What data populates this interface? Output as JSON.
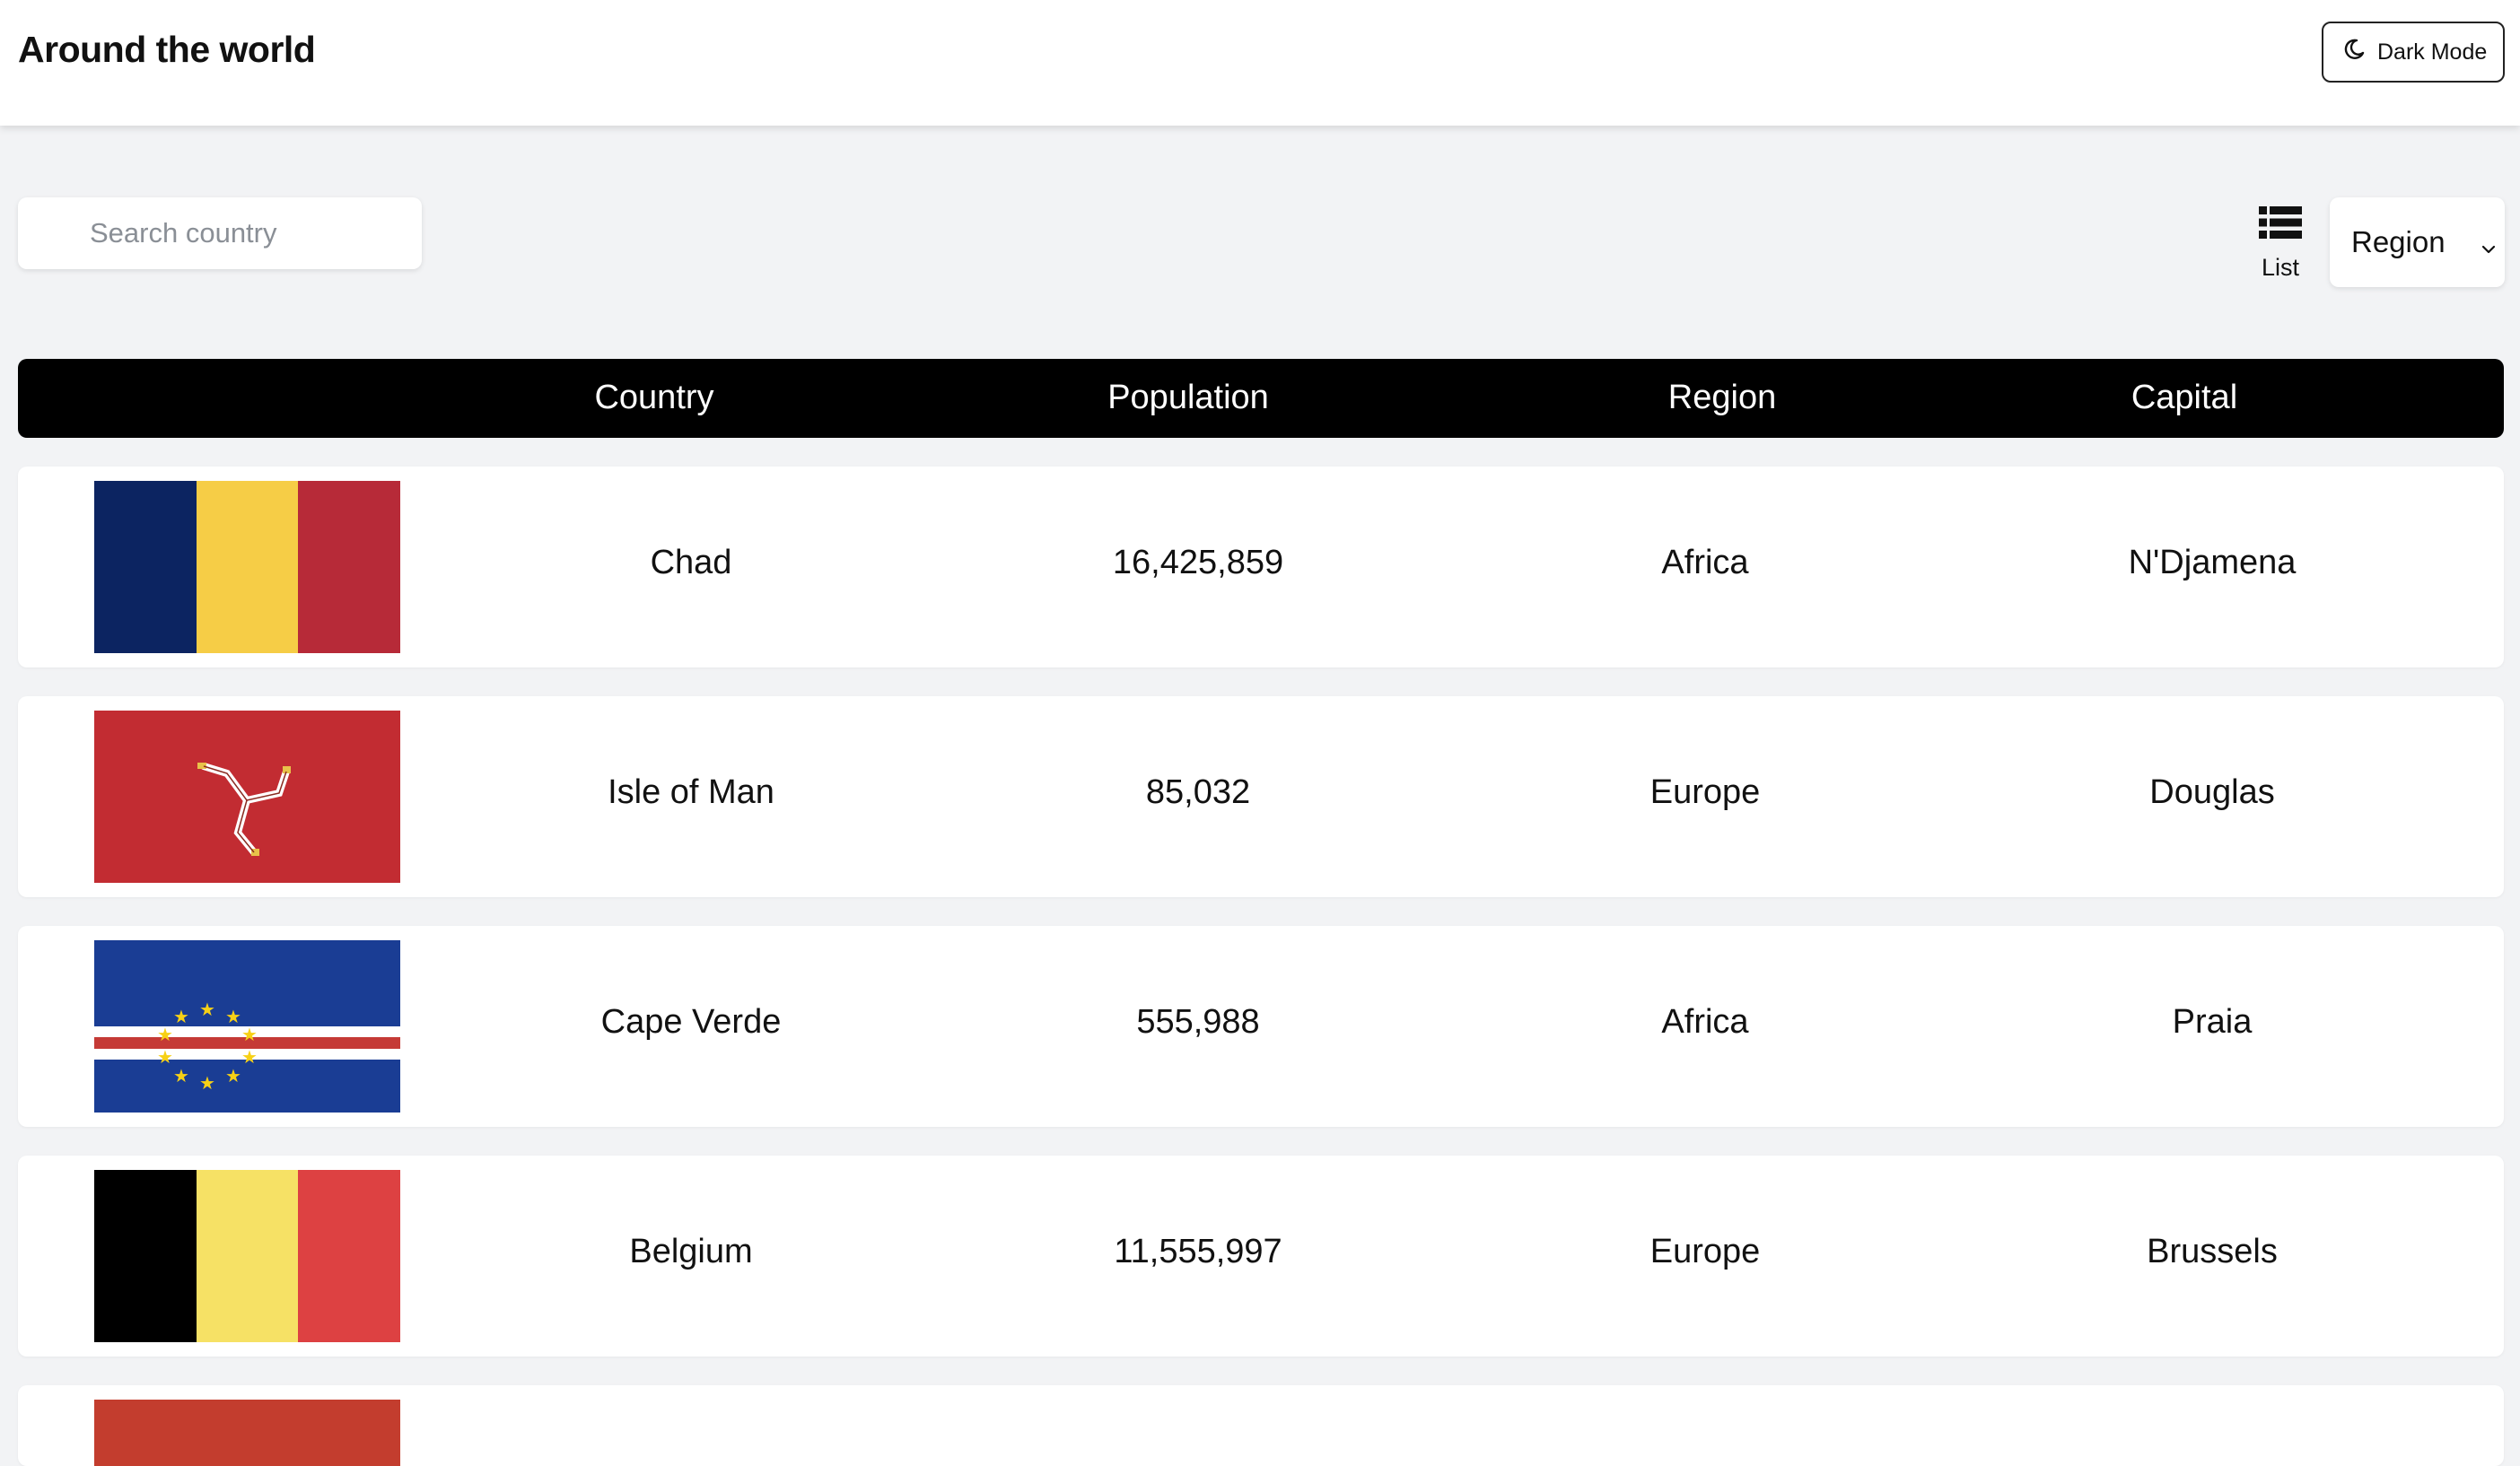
{
  "header": {
    "title": "Around the world",
    "dark_mode_label": "Dark Mode"
  },
  "search": {
    "placeholder": "Search country",
    "value": ""
  },
  "view_toggle": {
    "label": "List",
    "icon": "list-icon"
  },
  "region_filter": {
    "selected": "Region",
    "icon": "chevron-down-icon"
  },
  "table": {
    "columns": [
      "Country",
      "Population",
      "Region",
      "Capital"
    ],
    "rows": [
      {
        "flag": "chad-flag",
        "country": "Chad",
        "population": "16,425,859",
        "region": "Africa",
        "capital": "N'Djamena"
      },
      {
        "flag": "isle-of-man-flag",
        "country": "Isle of Man",
        "population": "85,032",
        "region": "Europe",
        "capital": "Douglas"
      },
      {
        "flag": "cape-verde-flag",
        "country": "Cape Verde",
        "population": "555,988",
        "region": "Africa",
        "capital": "Praia"
      },
      {
        "flag": "belgium-flag",
        "country": "Belgium",
        "population": "11,555,997",
        "region": "Europe",
        "capital": "Brussels"
      }
    ]
  },
  "colors": {
    "page_bg": "#f2f3f5",
    "header_bg": "#000000",
    "card_bg": "#ffffff"
  }
}
